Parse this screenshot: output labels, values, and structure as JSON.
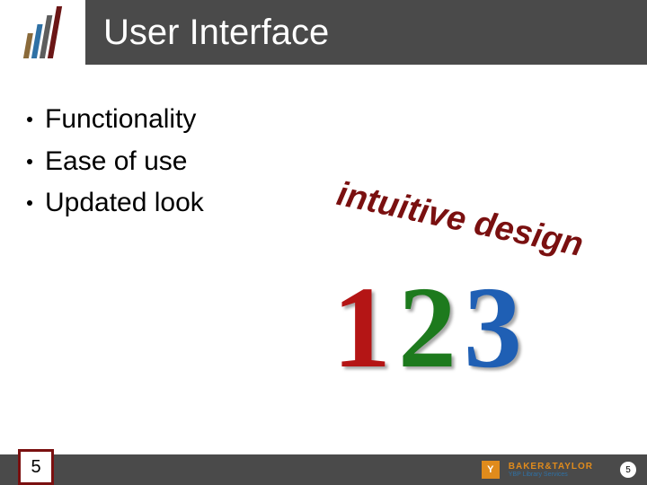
{
  "header": {
    "title": "User Interface"
  },
  "bullets": [
    "Functionality",
    "Ease of use",
    "Updated look"
  ],
  "callout": "intuitive design",
  "graphic": {
    "n1": "1",
    "n2": "2",
    "n3": "3"
  },
  "footer": {
    "page_number_left": "5",
    "page_number_right": "5",
    "brand_glyph": "Y",
    "brand_main": "BAKER&TAYLOR",
    "brand_sub": "YBP Library Services"
  }
}
